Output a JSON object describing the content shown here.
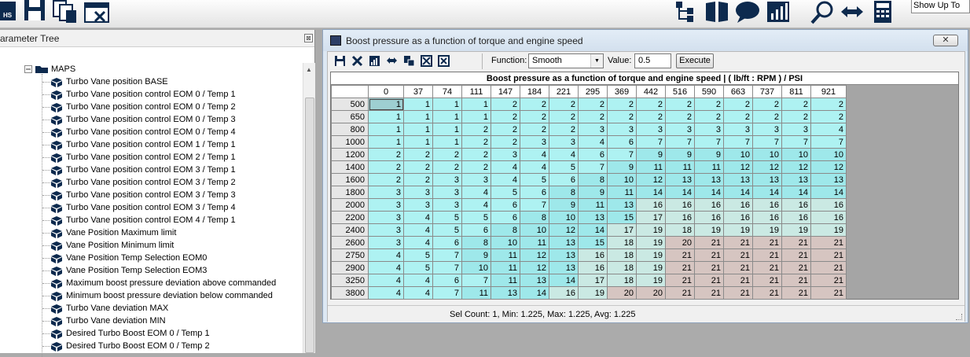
{
  "toolbar": {
    "show_up_to": "Show Up To",
    "icons": [
      "open-hs-icon",
      "save-icon",
      "copy-icon",
      "export-delete-icon",
      "tree-icon",
      "book-icon",
      "chat-icon",
      "chart-icon",
      "search-icon",
      "arrows-icon",
      "calculator-icon"
    ]
  },
  "tree": {
    "title": "arameter Tree",
    "close": "⊠",
    "folder": "MAPS",
    "items": [
      "Turbo Vane position BASE",
      "Turbo Vane position control EOM 0 / Temp 1",
      "Turbo Vane position control EOM 0 / Temp 2",
      "Turbo Vane position control EOM 0 / Temp 3",
      "Turbo Vane position control EOM 0 / Temp 4",
      "Turbo Vane position control EOM 1 / Temp 1",
      "Turbo Vane position control EOM 2 / Temp 1",
      "Turbo Vane position control EOM 3 / Temp 1",
      "Turbo Vane position control EOM 3 / Temp 2",
      "Turbo Vane position control EOM 3 / Temp 3",
      "Turbo Vane position control EOM 3 / Temp 4",
      "Turbo Vane position control EOM 4 / Temp 1",
      "Vane Position Maximum limit",
      "Vane Position Minimum limit",
      "Vane Position Temp Selection EOM0",
      "Vane Position Temp Selection EOM3",
      "Maximum boost pressure deviation above commanded",
      "Minimum boost pressure deviation below commanded",
      "Turbo Vane deviation MAX",
      "Turbo Vane deviation MIN",
      "Desired Turbo Boost EOM 0 / Temp 1",
      "Desired Turbo Boost EOM 0 / Temp 2"
    ]
  },
  "window": {
    "title": "Boost pressure as a function of torque and engine speed",
    "close": "✕"
  },
  "grid_toolbar": {
    "function_label": "Function:",
    "function_value": "Smooth",
    "value_label": "Value:",
    "value": "0.5",
    "execute": "Execute",
    "icons": [
      "save-icon",
      "delete-icon",
      "chart-icon",
      "swap-icon",
      "copy-icon",
      "smooth-icon",
      "clear-icon"
    ]
  },
  "grid": {
    "title": "Boost pressure as a function of torque and engine speed |  ( lb/ft : RPM ) / PSI",
    "columns": [
      "0",
      "37",
      "74",
      "111",
      "147",
      "184",
      "221",
      "295",
      "369",
      "442",
      "516",
      "590",
      "663",
      "737",
      "811",
      "921"
    ],
    "rows": [
      {
        "rpm": "500",
        "v": [
          1,
          1,
          1,
          1,
          2,
          2,
          2,
          2,
          2,
          2,
          2,
          2,
          2,
          2,
          2,
          2
        ]
      },
      {
        "rpm": "650",
        "v": [
          1,
          1,
          1,
          1,
          2,
          2,
          2,
          2,
          2,
          2,
          2,
          2,
          2,
          2,
          2,
          2
        ]
      },
      {
        "rpm": "800",
        "v": [
          1,
          1,
          1,
          2,
          2,
          2,
          2,
          3,
          3,
          3,
          3,
          3,
          3,
          3,
          3,
          4
        ]
      },
      {
        "rpm": "1000",
        "v": [
          1,
          1,
          1,
          2,
          2,
          3,
          3,
          4,
          6,
          7,
          7,
          7,
          7,
          7,
          7,
          7
        ]
      },
      {
        "rpm": "1200",
        "v": [
          2,
          2,
          2,
          2,
          3,
          4,
          4,
          6,
          7,
          9,
          9,
          9,
          10,
          10,
          10,
          10
        ]
      },
      {
        "rpm": "1400",
        "v": [
          2,
          2,
          2,
          2,
          4,
          4,
          5,
          7,
          9,
          11,
          11,
          11,
          12,
          12,
          12,
          12
        ]
      },
      {
        "rpm": "1600",
        "v": [
          2,
          2,
          3,
          3,
          4,
          5,
          6,
          8,
          10,
          12,
          13,
          13,
          13,
          13,
          13,
          13
        ]
      },
      {
        "rpm": "1800",
        "v": [
          3,
          3,
          3,
          4,
          5,
          6,
          8,
          9,
          11,
          14,
          14,
          14,
          14,
          14,
          14,
          14
        ]
      },
      {
        "rpm": "2000",
        "v": [
          3,
          3,
          3,
          4,
          6,
          7,
          9,
          11,
          13,
          16,
          16,
          16,
          16,
          16,
          16,
          16
        ]
      },
      {
        "rpm": "2200",
        "v": [
          3,
          4,
          5,
          5,
          6,
          8,
          10,
          13,
          15,
          17,
          16,
          16,
          16,
          16,
          16,
          16
        ]
      },
      {
        "rpm": "2400",
        "v": [
          3,
          4,
          5,
          6,
          8,
          10,
          12,
          14,
          17,
          19,
          18,
          19,
          19,
          19,
          19,
          19
        ]
      },
      {
        "rpm": "2600",
        "v": [
          3,
          4,
          6,
          8,
          10,
          11,
          13,
          15,
          18,
          19,
          20,
          21,
          21,
          21,
          21,
          21
        ]
      },
      {
        "rpm": "2750",
        "v": [
          4,
          5,
          7,
          9,
          11,
          12,
          13,
          16,
          18,
          19,
          21,
          21,
          21,
          21,
          21,
          21
        ]
      },
      {
        "rpm": "2900",
        "v": [
          4,
          5,
          7,
          10,
          11,
          12,
          13,
          16,
          18,
          19,
          21,
          21,
          21,
          21,
          21,
          21
        ]
      },
      {
        "rpm": "3250",
        "v": [
          4,
          4,
          6,
          7,
          11,
          13,
          14,
          17,
          18,
          19,
          21,
          21,
          21,
          21,
          21,
          21
        ]
      },
      {
        "rpm": "3800",
        "v": [
          4,
          4,
          7,
          11,
          13,
          14,
          16,
          19,
          20,
          20,
          21,
          21,
          21,
          21,
          21,
          21
        ]
      }
    ],
    "selected": {
      "row": 0,
      "col": 0
    },
    "colors": {
      "low": "#aef2f2",
      "mid": "#9ee8ea",
      "high": "#cae9e3",
      "max": "#d6c5c1"
    }
  },
  "status": "Sel Count: 1, Min: 1.225, Max: 1.225, Avg: 1.225"
}
